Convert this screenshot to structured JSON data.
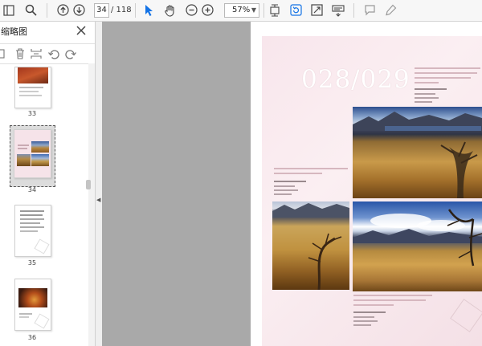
{
  "toolbar": {
    "current_page": "34",
    "page_total": "/ 118",
    "zoom": "57%"
  },
  "panel": {
    "title": "缩略图",
    "thumbnails": [
      {
        "label": "33"
      },
      {
        "label": "34"
      },
      {
        "label": "35"
      },
      {
        "label": "36"
      }
    ]
  },
  "document": {
    "page_numbers": "028/029"
  },
  "colors": {
    "accent_blue": "#1473e6",
    "toolbar_bg": "#f7f7f7",
    "view_bg": "#a9a9a9",
    "spread_pink": "#f8e6ec"
  }
}
